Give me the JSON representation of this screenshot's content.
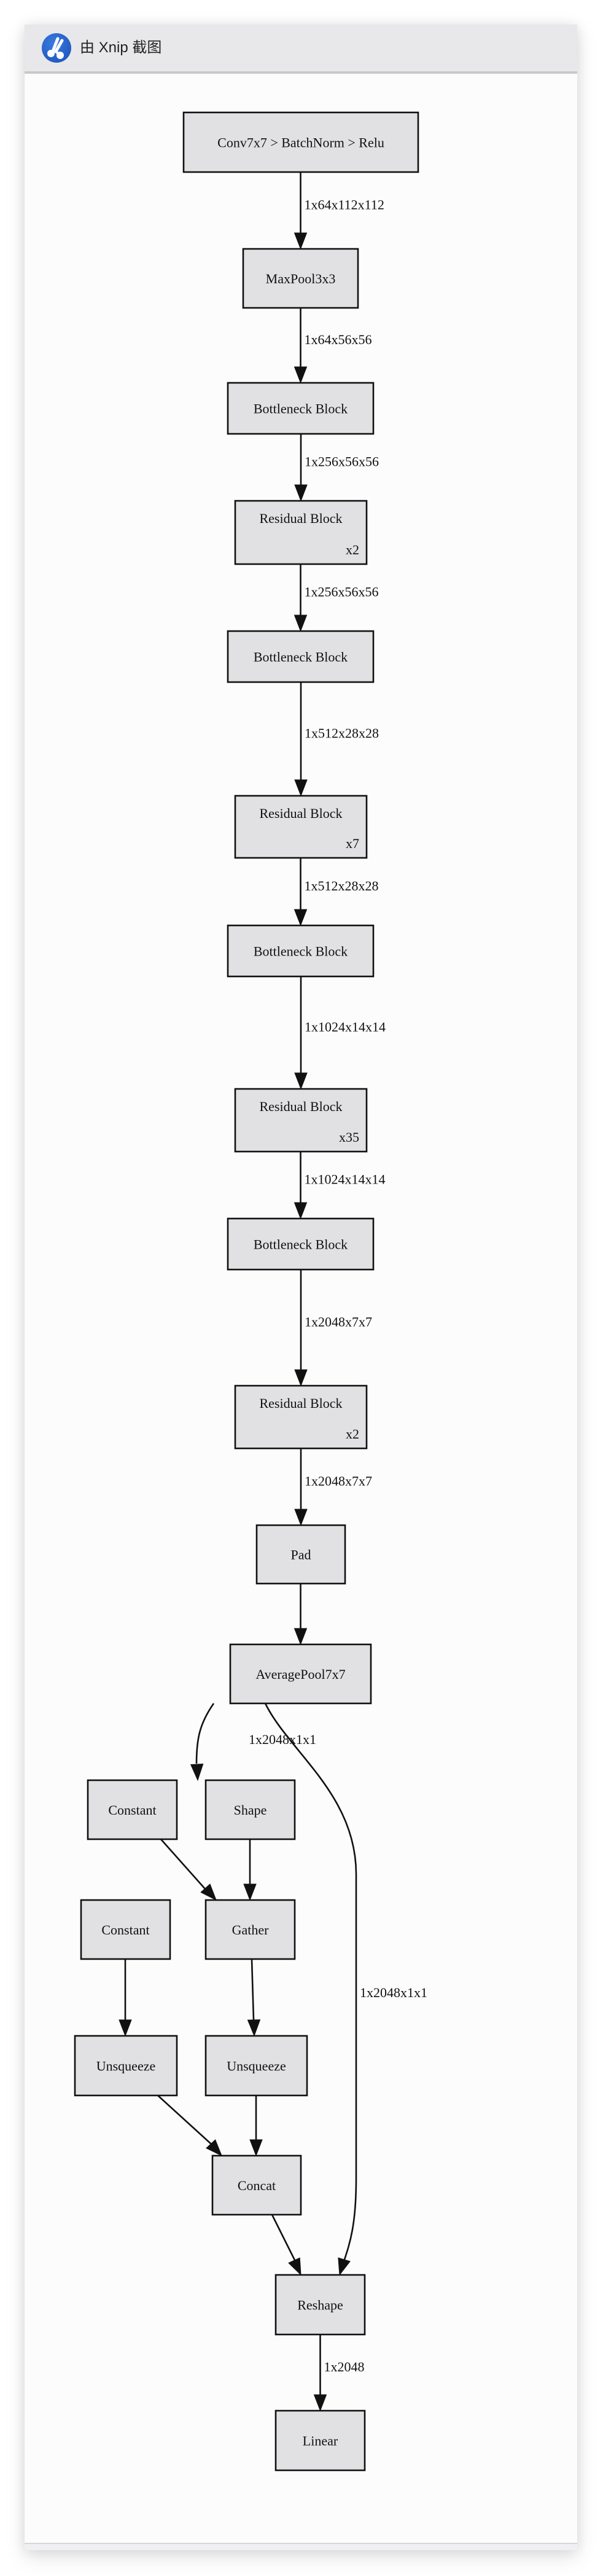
{
  "window": {
    "title": "由 Xnip 截图",
    "logo_icon": "xnip-scissors-icon",
    "accent_color": "#2261cf"
  },
  "graph": {
    "node_fill": "#e1e0e3",
    "nodes": [
      {
        "id": "conv",
        "label": "Conv7x7 > BatchNorm > Relu"
      },
      {
        "id": "maxpool",
        "label": "MaxPool3x3"
      },
      {
        "id": "bottleneck1",
        "label": "Bottleneck Block"
      },
      {
        "id": "residual1",
        "label": "Residual Block",
        "repeat": "x2"
      },
      {
        "id": "bottleneck2",
        "label": "Bottleneck Block"
      },
      {
        "id": "residual2",
        "label": "Residual Block",
        "repeat": "x7"
      },
      {
        "id": "bottleneck3",
        "label": "Bottleneck Block"
      },
      {
        "id": "residual3",
        "label": "Residual Block",
        "repeat": "x35"
      },
      {
        "id": "bottleneck4",
        "label": "Bottleneck Block"
      },
      {
        "id": "residual4",
        "label": "Residual Block",
        "repeat": "x2"
      },
      {
        "id": "pad",
        "label": "Pad"
      },
      {
        "id": "avgpool",
        "label": "AveragePool7x7"
      },
      {
        "id": "constant1",
        "label": "Constant"
      },
      {
        "id": "shape",
        "label": "Shape"
      },
      {
        "id": "constant2",
        "label": "Constant"
      },
      {
        "id": "gather",
        "label": "Gather"
      },
      {
        "id": "unsqueeze1",
        "label": "Unsqueeze"
      },
      {
        "id": "unsqueeze2",
        "label": "Unsqueeze"
      },
      {
        "id": "concat",
        "label": "Concat"
      },
      {
        "id": "reshape",
        "label": "Reshape"
      },
      {
        "id": "linear",
        "label": "Linear"
      }
    ],
    "edges": [
      {
        "from": "conv",
        "to": "maxpool",
        "label": "1x64x112x112"
      },
      {
        "from": "maxpool",
        "to": "bottleneck1",
        "label": "1x64x56x56"
      },
      {
        "from": "bottleneck1",
        "to": "residual1",
        "label": "1x256x56x56"
      },
      {
        "from": "residual1",
        "to": "bottleneck2",
        "label": "1x256x56x56"
      },
      {
        "from": "bottleneck2",
        "to": "residual2",
        "label": "1x512x28x28"
      },
      {
        "from": "residual2",
        "to": "bottleneck3",
        "label": "1x512x28x28"
      },
      {
        "from": "bottleneck3",
        "to": "residual3",
        "label": "1x1024x14x14"
      },
      {
        "from": "residual3",
        "to": "bottleneck4",
        "label": "1x1024x14x14"
      },
      {
        "from": "bottleneck4",
        "to": "residual4",
        "label": "1x2048x7x7"
      },
      {
        "from": "residual4",
        "to": "pad",
        "label": "1x2048x7x7"
      },
      {
        "from": "pad",
        "to": "avgpool",
        "label": ""
      },
      {
        "from": "avgpool",
        "to": "shape",
        "label": "1x2048x1x1"
      },
      {
        "from": "avgpool",
        "to": "reshape",
        "label": "1x2048x1x1"
      },
      {
        "from": "constant1",
        "to": "gather",
        "label": ""
      },
      {
        "from": "shape",
        "to": "gather",
        "label": ""
      },
      {
        "from": "constant2",
        "to": "unsqueeze1",
        "label": ""
      },
      {
        "from": "gather",
        "to": "unsqueeze2",
        "label": ""
      },
      {
        "from": "unsqueeze1",
        "to": "concat",
        "label": ""
      },
      {
        "from": "unsqueeze2",
        "to": "concat",
        "label": ""
      },
      {
        "from": "concat",
        "to": "reshape",
        "label": ""
      },
      {
        "from": "reshape",
        "to": "linear",
        "label": "1x2048"
      }
    ]
  }
}
